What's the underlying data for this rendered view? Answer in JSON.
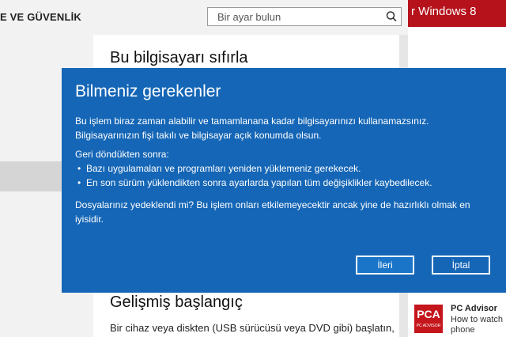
{
  "settings": {
    "header_title": "E VE GÜVENLİK",
    "search_placeholder": "Bir ayar bulun",
    "section_title": "Bu bilgisayarı sıfırla",
    "advanced_title": "Gelişmiş başlangıç",
    "advanced_text": "Bir cihaz veya diskten (USB sürücüsü veya DVD gibi) başlatın,"
  },
  "article": {
    "banner_title": "r Windows 8",
    "tweet_logo_text": "PCA",
    "tweet_logo_sub": "PC ADVISOR",
    "tweet_name": "PC Advisor",
    "tweet_text_line1": "How to watch",
    "tweet_text_line2": "phone"
  },
  "dialog": {
    "title": "Bilmeniz gerekenler",
    "paragraph1": "Bu işlem biraz zaman alabilir ve tamamlanana kadar bilgisayarınızı kullanamazsınız. Bilgisayarınızın fişi takılı ve bilgisayar açık konumda olsun.",
    "paragraph2": "Geri döndükten sonra:",
    "bullets": [
      "Bazı uygulamaları ve programları yeniden yüklemeniz gerekecek.",
      "En son sürüm yüklendikten sonra ayarlarda yapılan tüm değişiklikler kaybedilecek."
    ],
    "paragraph3": "Dosyalarınız yedeklendi mi? Bu işlem onları etkilemeyecektir ancak yine de hazırlıklı olmak en iyisidir.",
    "next_label": "İleri",
    "cancel_label": "İptal"
  },
  "icons": {
    "bullet": "•",
    "search": "search-icon"
  },
  "colors": {
    "dialog_background": "#1566b6",
    "banner_red": "#b5121b"
  }
}
